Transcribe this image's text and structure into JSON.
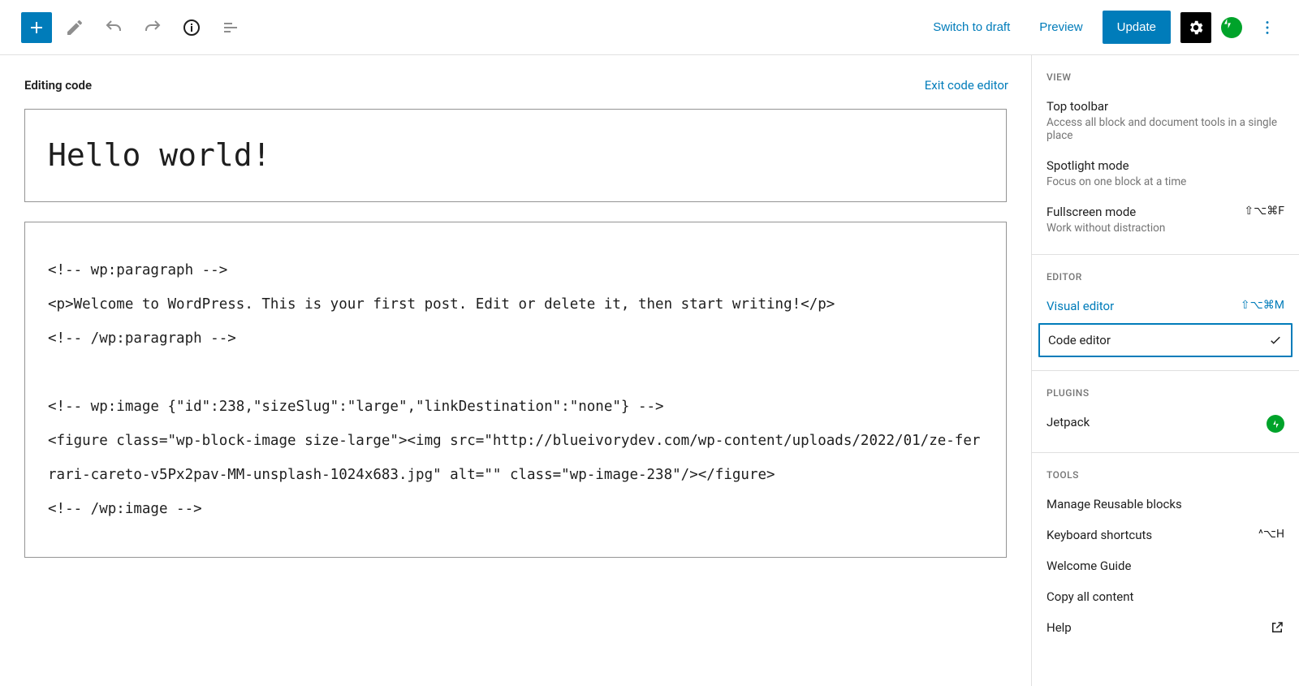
{
  "toolbar": {
    "switch_to_draft": "Switch to draft",
    "preview": "Preview",
    "update": "Update"
  },
  "main": {
    "editing_label": "Editing code",
    "exit_label": "Exit code editor",
    "post_title": "Hello world!",
    "code_content": "<!-- wp:paragraph -->\n<p>Welcome to WordPress. This is your first post. Edit or delete it, then start writing!</p>\n<!-- /wp:paragraph -->\n\n<!-- wp:image {\"id\":238,\"sizeSlug\":\"large\",\"linkDestination\":\"none\"} -->\n<figure class=\"wp-block-image size-large\"><img src=\"http://blueivorydev.com/wp-content/uploads/2022/01/ze-ferrari-careto-v5Px2pav-MM-unsplash-1024x683.jpg\" alt=\"\" class=\"wp-image-238\"/></figure>\n<!-- /wp:image -->"
  },
  "panel": {
    "view": {
      "heading": "View",
      "top_toolbar": {
        "label": "Top toolbar",
        "desc": "Access all block and document tools in a single place"
      },
      "spotlight": {
        "label": "Spotlight mode",
        "desc": "Focus on one block at a time"
      },
      "fullscreen": {
        "label": "Fullscreen mode",
        "desc": "Work without distraction",
        "shortcut": "⇧⌥⌘F"
      }
    },
    "editor": {
      "heading": "Editor",
      "visual": {
        "label": "Visual editor",
        "shortcut": "⇧⌥⌘M"
      },
      "code": {
        "label": "Code editor"
      }
    },
    "plugins": {
      "heading": "Plugins",
      "jetpack": "Jetpack"
    },
    "tools": {
      "heading": "Tools",
      "reusable": "Manage Reusable blocks",
      "shortcuts": {
        "label": "Keyboard shortcuts",
        "shortcut": "^⌥H"
      },
      "welcome": "Welcome Guide",
      "copy": "Copy all content",
      "help": "Help"
    }
  }
}
